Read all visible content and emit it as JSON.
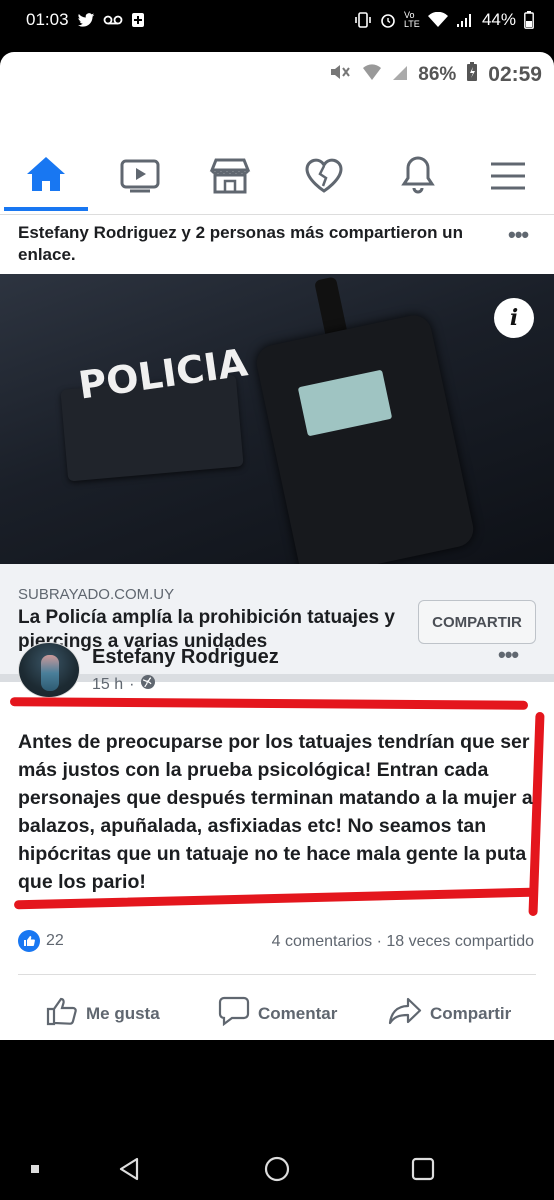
{
  "outer_status": {
    "time": "01:03",
    "battery": "44%",
    "volte": "Vo LTE"
  },
  "inner_status": {
    "battery": "86%",
    "time": "02:59"
  },
  "nav": {
    "icons": [
      "home-icon",
      "video-icon",
      "marketplace-icon",
      "heart-icon",
      "bell-icon",
      "menu-icon"
    ],
    "accent": "#1877f2"
  },
  "share_notice": "Estefany Rodriguez y 2 personas más compartieron un enlace.",
  "article_image": {
    "patch_text": "POLICIA",
    "info_badge": "i"
  },
  "link": {
    "domain": "SUBRAYADO.COM.UY",
    "title": "La Policía amplía la prohibición tatuajes y piercings a varias unidades",
    "share_button": "COMPARTIR"
  },
  "post": {
    "author": "Estefany Rodriguez",
    "time": "15 h",
    "text": "Antes de preocuparse por los tatuajes tendrían que ser más justos con la prueba psicológica! Entran cada personajes que después terminan matando a la mujer a balazos, apuñalada, asfixiadas etc! No seamos tan hipócritas que un tatuaje no te hace mala gente la puta que los pario!",
    "reactions_count": "22",
    "counts_text": "4 comentarios · 18 veces compartido",
    "actions": {
      "like": "Me gusta",
      "comment": "Comentar",
      "share": "Compartir"
    },
    "annotation_color": "#e4161d"
  }
}
